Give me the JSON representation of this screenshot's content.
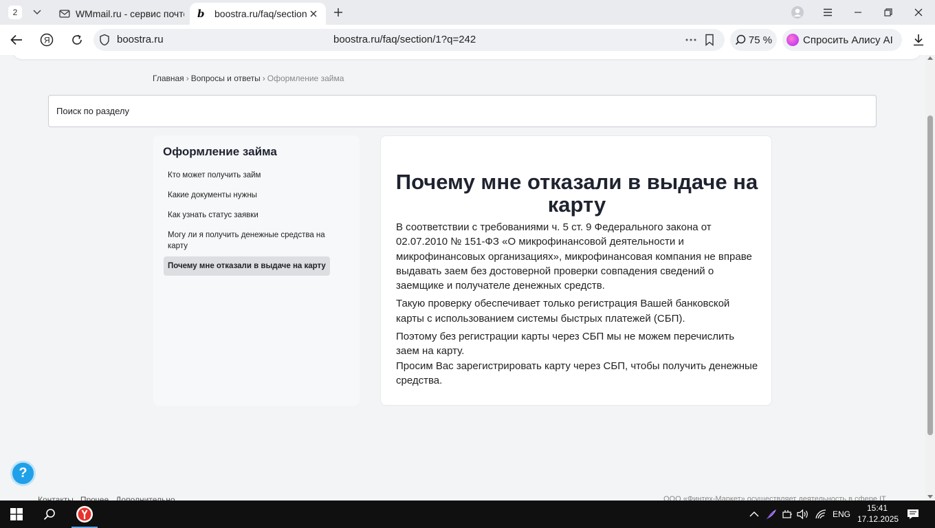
{
  "browser": {
    "tab_count": "2",
    "tabs": [
      {
        "title": "WMmail.ru - сервис почтов"
      },
      {
        "title": "boostra.ru/faq/section/"
      }
    ],
    "url_host": "boostra.ru",
    "url_full": "boostra.ru/faq/section/1?q=242",
    "zoom": "75 %",
    "alice_label": "Спросить Алису AI"
  },
  "page": {
    "breadcrumb": {
      "home": "Главная",
      "sep1": "›",
      "faq": "Вопросы и ответы",
      "sep2": "›",
      "current": "Оформление займа"
    },
    "search": {
      "placeholder": "Поиск по разделу"
    },
    "sidebar": {
      "title": "Оформление займа",
      "items": [
        {
          "label": "Кто может получить займ"
        },
        {
          "label": "Какие документы нужны"
        },
        {
          "label": "Как узнать статус заявки"
        },
        {
          "label": "Могу ли я получить денежные средства на карту"
        },
        {
          "label": "Почему мне отказали в выдаче на карту"
        }
      ]
    },
    "article": {
      "title": "Почему мне отказали в выдаче на карту",
      "paragraphs": [
        "В соответствии с требованиями ч. 5 ст. 9 Федерального закона от 02.07.2010 № 151-ФЗ «О микрофинансовой деятельности и микрофинансовых организациях», микрофинансовая компания не вправе выдавать заем без достоверной проверки совпадения сведений о заемщике и получателе денежных средств.",
        "Такую проверку обеспечивает только регистрация Вашей банковской карты с использованием системы быстрых платежей (СБП).",
        "Поэтому без регистрации карты через СБП мы не можем перечислить заем на карту.",
        "Просим Вас зарегистрировать карту через СБП, чтобы получить денежные средства."
      ]
    },
    "help_button": "?",
    "footer": {
      "links": [
        "Контакты",
        "Прочее",
        "Дополнительно"
      ],
      "note": "ООО «Финтех-Маркет» осуществляет деятельность в сфере IT"
    }
  },
  "taskbar": {
    "lang": "ENG",
    "time": "15:41",
    "date": "17.12.2025"
  }
}
